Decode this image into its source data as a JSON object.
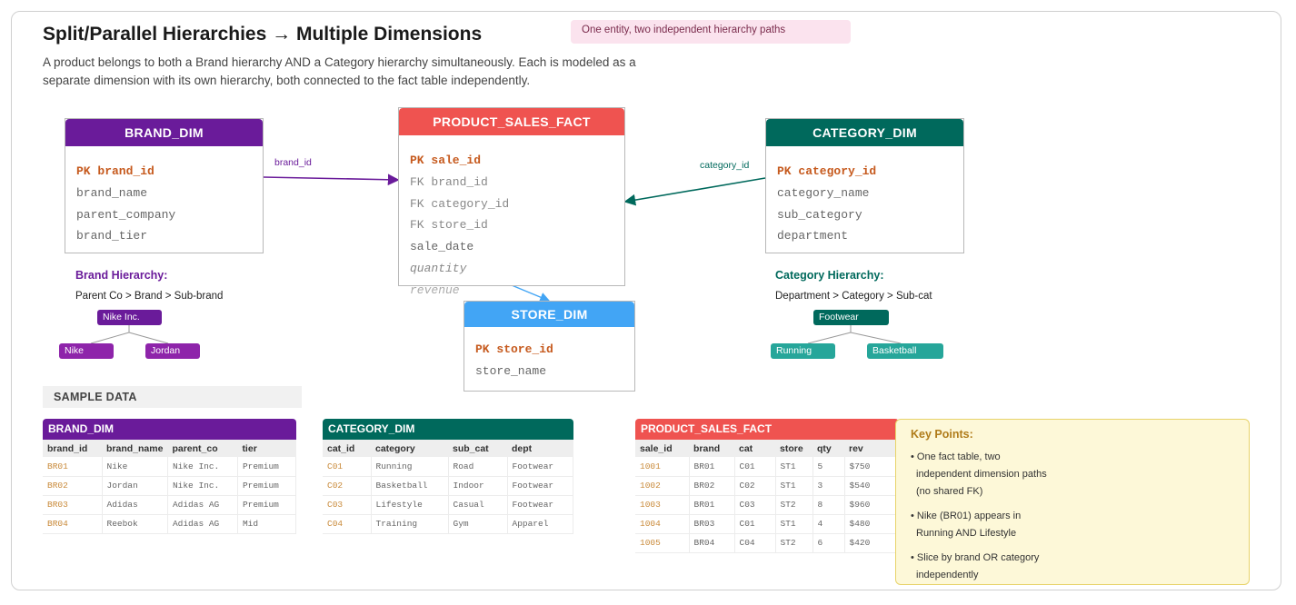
{
  "header": {
    "title": "Split/Parallel Hierarchies → Multiple Dimensions",
    "subtitle": "A product belongs to both a Brand hierarchy AND a Category hierarchy simultaneously. Each is modeled as a separate dimension with its own hierarchy, both connected to the fact table independently.",
    "note": "One entity, two independent hierarchy paths"
  },
  "colors": {
    "brand": "#6a1b9a",
    "brand_chip": "#8e24aa",
    "category": "#00695c",
    "category_chip": "#26a69a",
    "fact": "#ef5350",
    "store": "#42a5f5"
  },
  "diagram": {
    "brand_dim": {
      "title": "BRAND_DIM",
      "fields": [
        "PK brand_id",
        "brand_name",
        "parent_company",
        "brand_tier"
      ]
    },
    "fact": {
      "title": "PRODUCT_SALES_FACT",
      "fields": [
        "PK sale_id",
        "FK brand_id",
        "FK category_id",
        "FK store_id",
        "sale_date",
        "quantity",
        "revenue"
      ]
    },
    "category_dim": {
      "title": "CATEGORY_DIM",
      "fields": [
        "PK category_id",
        "category_name",
        "sub_category",
        "department"
      ]
    },
    "store_dim": {
      "title": "STORE_DIM",
      "fields": [
        "PK store_id",
        "store_name"
      ]
    },
    "connectors": {
      "brand": "brand_id",
      "category": "category_id"
    },
    "brand_hierarchy": {
      "title": "Brand Hierarchy:",
      "path": "Parent Co > Brand > Sub-brand",
      "root": "Nike Inc.",
      "children": [
        "Nike",
        "Jordan"
      ]
    },
    "category_hierarchy": {
      "title": "Category Hierarchy:",
      "path": "Department > Category > Sub-cat",
      "root": "Footwear",
      "children": [
        "Running",
        "Basketball"
      ]
    }
  },
  "sample": {
    "label": "SAMPLE DATA",
    "brand_dim": {
      "title": "BRAND_DIM",
      "columns": [
        "brand_id",
        "brand_name",
        "parent_co",
        "tier"
      ],
      "rows": [
        [
          "BR01",
          "Nike",
          "Nike Inc.",
          "Premium"
        ],
        [
          "BR02",
          "Jordan",
          "Nike Inc.",
          "Premium"
        ],
        [
          "BR03",
          "Adidas",
          "Adidas AG",
          "Premium"
        ],
        [
          "BR04",
          "Reebok",
          "Adidas AG",
          "Mid"
        ]
      ]
    },
    "category_dim": {
      "title": "CATEGORY_DIM",
      "columns": [
        "cat_id",
        "category",
        "sub_cat",
        "dept"
      ],
      "rows": [
        [
          "C01",
          "Running",
          "Road",
          "Footwear"
        ],
        [
          "C02",
          "Basketball",
          "Indoor",
          "Footwear"
        ],
        [
          "C03",
          "Lifestyle",
          "Casual",
          "Footwear"
        ],
        [
          "C04",
          "Training",
          "Gym",
          "Apparel"
        ]
      ]
    },
    "fact": {
      "title": "PRODUCT_SALES_FACT",
      "columns": [
        "sale_id",
        "brand",
        "cat",
        "store",
        "qty",
        "rev"
      ],
      "rows": [
        [
          "1001",
          "BR01",
          "C01",
          "ST1",
          "5",
          "$750"
        ],
        [
          "1002",
          "BR02",
          "C02",
          "ST1",
          "3",
          "$540"
        ],
        [
          "1003",
          "BR01",
          "C03",
          "ST2",
          "8",
          "$960"
        ],
        [
          "1004",
          "BR03",
          "C01",
          "ST1",
          "4",
          "$480"
        ],
        [
          "1005",
          "BR04",
          "C04",
          "ST2",
          "6",
          "$420"
        ]
      ]
    }
  },
  "key_points": {
    "title": "Key Points:",
    "items": [
      "• One fact table, two independent dimension paths (no shared FK)",
      "• Nike (BR01) appears in Running AND Lifestyle",
      "• Slice by brand OR category independently"
    ]
  }
}
